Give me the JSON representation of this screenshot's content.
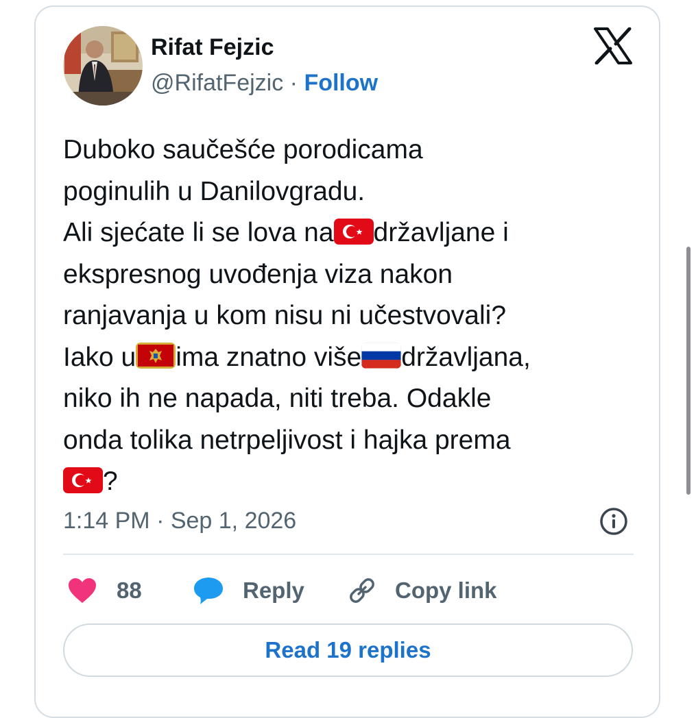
{
  "author": {
    "name": "Rifat Fejzic",
    "handle": "@RifatFejzic",
    "separator": "·",
    "follow_label": "Follow",
    "avatar_icon": "user-photo"
  },
  "platform_icon": "x-logo-icon",
  "tweet": {
    "lines": [
      [
        {
          "t": "Duboko saučešće porodicama"
        }
      ],
      [
        {
          "t": "poginulih u Danilovgradu."
        }
      ],
      [
        {
          "t": "Ali sjećate li se lova na"
        },
        {
          "flag": "turkey"
        },
        {
          "t": "državljane i"
        }
      ],
      [
        {
          "t": "ekspresnog uvođenja viza nakon"
        }
      ],
      [
        {
          "t": "ranjavanja u kom nisu ni učestvovali?"
        }
      ],
      [
        {
          "t": "Iako u"
        },
        {
          "flag": "montenegro"
        },
        {
          "t": "ima znatno više"
        },
        {
          "flag": "russia"
        },
        {
          "t": "državljana,"
        }
      ],
      [
        {
          "t": "niko ih ne napada, niti treba. Odakle"
        }
      ],
      [
        {
          "t": "onda tolika netrpeljivost i hajka prema"
        }
      ],
      [
        {
          "flag": "turkey"
        },
        {
          "t": "?"
        }
      ]
    ]
  },
  "timestamp": "1:14 PM · Sep 1, 2026",
  "actions": {
    "likes_count": "88",
    "reply_label": "Reply",
    "copy_link_label": "Copy link"
  },
  "read_replies_label": "Read 19 replies",
  "colors": {
    "link": "#1d72c9",
    "like_heart": "#f0337a",
    "reply_bubble": "#1d9bf0",
    "muted_text": "#536471"
  }
}
